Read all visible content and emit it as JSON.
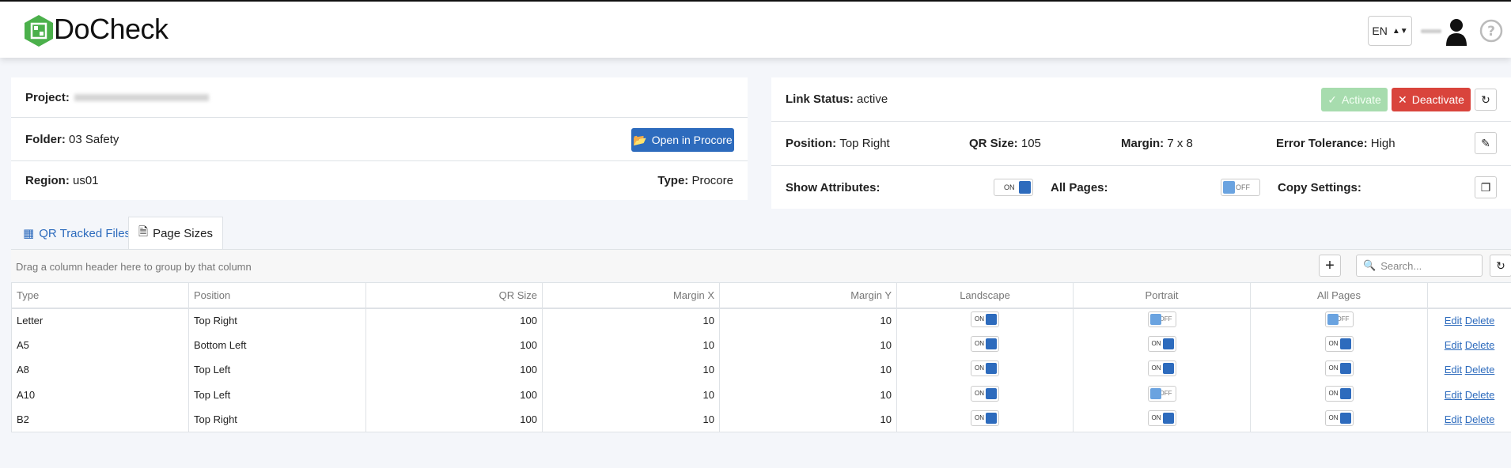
{
  "header": {
    "brand": "DoCheck",
    "language": "EN",
    "accent": "#4bb04b"
  },
  "project_panel": {
    "project_label": "Project:",
    "folder_label": "Folder:",
    "folder_value": "03 Safety",
    "open_button": "Open in Procore",
    "region_label": "Region:",
    "region_value": "us01",
    "type_label": "Type:",
    "type_value": "Procore"
  },
  "link_panel": {
    "link_status_label": "Link Status:",
    "link_status_value": "active",
    "activate_button": "Activate",
    "deactivate_button": "Deactivate",
    "position_label": "Position:",
    "position_value": "Top Right",
    "qr_size_label": "QR Size:",
    "qr_size_value": "105",
    "margin_label": "Margin:",
    "margin_value": "7 x 8",
    "error_tolerance_label": "Error Tolerance:",
    "error_tolerance_value": "High",
    "show_attributes_label": "Show Attributes:",
    "show_attributes_state": "ON",
    "all_pages_label": "All Pages:",
    "all_pages_state": "OFF",
    "copy_settings_label": "Copy Settings:"
  },
  "tabs": [
    {
      "label": "QR Tracked Files",
      "active": false
    },
    {
      "label": "Page Sizes",
      "active": true
    }
  ],
  "grid": {
    "drag_hint": "Drag a column header here to group by that column",
    "search_placeholder": "Search...",
    "columns": [
      "Type",
      "Position",
      "QR Size",
      "Margin X",
      "Margin Y",
      "Landscape",
      "Portrait",
      "All Pages"
    ],
    "edit_label": "Edit",
    "delete_label": "Delete",
    "rows": [
      {
        "type": "Letter",
        "position": "Top Right",
        "qr_size": "100",
        "margin_x": "10",
        "margin_y": "10",
        "landscape": "ON",
        "portrait": "OFF",
        "all_pages": "OFF"
      },
      {
        "type": "A5",
        "position": "Bottom Left",
        "qr_size": "100",
        "margin_x": "10",
        "margin_y": "10",
        "landscape": "ON",
        "portrait": "ON",
        "all_pages": "ON"
      },
      {
        "type": "A8",
        "position": "Top Left",
        "qr_size": "100",
        "margin_x": "10",
        "margin_y": "10",
        "landscape": "ON",
        "portrait": "ON",
        "all_pages": "ON"
      },
      {
        "type": "A10",
        "position": "Top Left",
        "qr_size": "100",
        "margin_x": "10",
        "margin_y": "10",
        "landscape": "ON",
        "portrait": "OFF",
        "all_pages": "ON"
      },
      {
        "type": "B2",
        "position": "Top Right",
        "qr_size": "100",
        "margin_x": "10",
        "margin_y": "10",
        "landscape": "ON",
        "portrait": "ON",
        "all_pages": "ON"
      }
    ]
  }
}
